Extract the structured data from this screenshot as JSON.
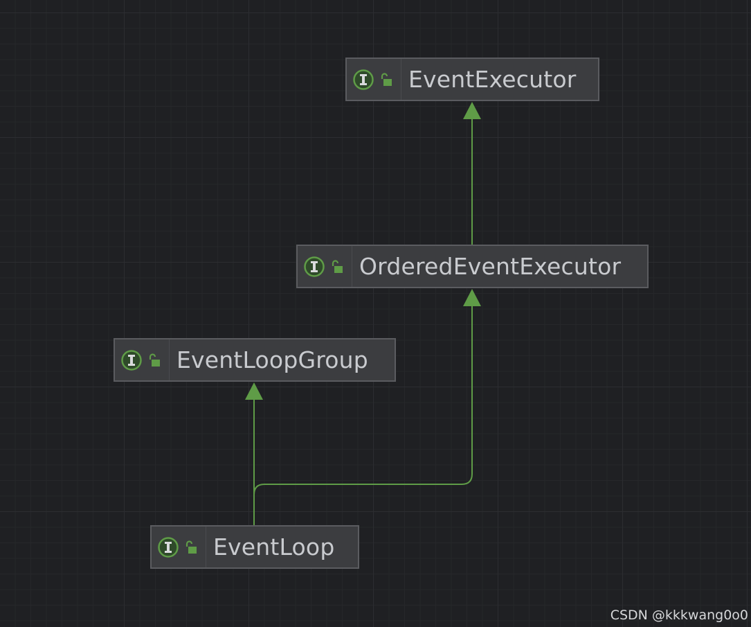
{
  "diagram": {
    "nodes": [
      {
        "id": "event-executor",
        "label": "EventExecutor",
        "kind": "interface-icon",
        "visibility": "unlocked-icon"
      },
      {
        "id": "ordered-event-executor",
        "label": "OrderedEventExecutor",
        "kind": "interface-icon",
        "visibility": "unlocked-icon"
      },
      {
        "id": "event-loop-group",
        "label": "EventLoopGroup",
        "kind": "interface-icon",
        "visibility": "unlocked-icon"
      },
      {
        "id": "event-loop",
        "label": "EventLoop",
        "kind": "interface-icon",
        "visibility": "unlocked-icon"
      }
    ],
    "edges": [
      {
        "from": "ordered-event-executor",
        "to": "event-executor",
        "type": "extends"
      },
      {
        "from": "event-loop",
        "to": "event-loop-group",
        "type": "extends"
      },
      {
        "from": "event-loop",
        "to": "ordered-event-executor",
        "type": "extends"
      }
    ]
  },
  "watermark": "CSDN @kkkwang0o0",
  "colors": {
    "background": "#1f2023",
    "node_fill": "#3c3d40",
    "node_border": "#5b5c60",
    "node_text": "#c9cbcf",
    "edge": "#5f9c47",
    "icon_green": "#5f9c47"
  }
}
